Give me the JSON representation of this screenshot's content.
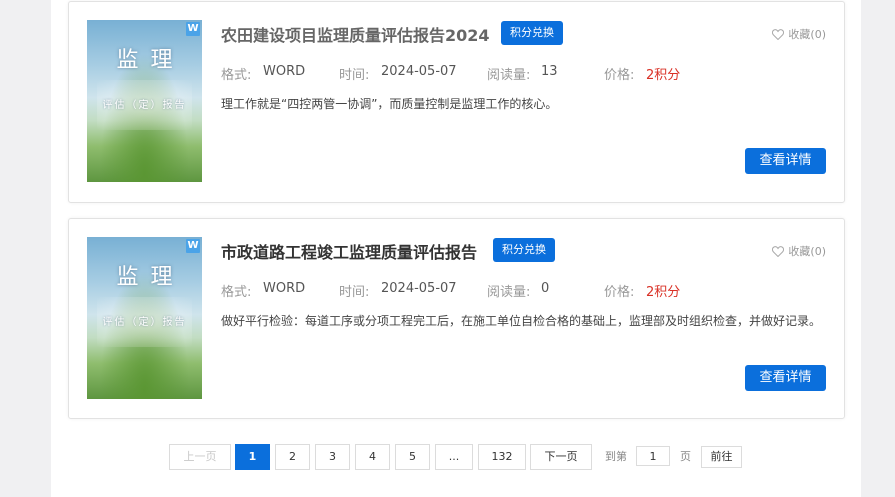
{
  "items": [
    {
      "cover": {
        "big": "监理",
        "small": "评估（定）报告",
        "badge": "W"
      },
      "title": "农田建设项目监理质量评估报告2024",
      "exchange_label": "积分兑换",
      "favorite_label": "收藏(0)",
      "format_label": "格式:",
      "format_value": "WORD",
      "time_label": "时间:",
      "time_value": "2024-05-07",
      "reads_label": "阅读量:",
      "reads_value": "13",
      "price_label": "价格:",
      "price_value": "2积分",
      "description": "理工作就是“四控两管一协调”，而质量控制是监理工作的核心。",
      "detail_label": "查看详情"
    },
    {
      "cover": {
        "big": "监理",
        "small": "评估（定）报告",
        "badge": "W"
      },
      "title": "市政道路工程竣工监理质量评估报告",
      "exchange_label": "积分兑换",
      "favorite_label": "收藏(0)",
      "format_label": "格式:",
      "format_value": "WORD",
      "time_label": "时间:",
      "time_value": "2024-05-07",
      "reads_label": "阅读量:",
      "reads_value": "0",
      "price_label": "价格:",
      "price_value": "2积分",
      "description": "做好平行检验：每道工序或分项工程完工后，在施工单位自检合格的基础上，监理部及时组织检查，并做好记录。",
      "detail_label": "查看详情"
    }
  ],
  "pagination": {
    "prev_label": "上一页",
    "pages": [
      "1",
      "2",
      "3",
      "4",
      "5",
      "...",
      "132"
    ],
    "current": "1",
    "next_label": "下一页",
    "goto_label": "到第",
    "goto_value": "1",
    "page_unit": "页",
    "go_label": "前往"
  },
  "colors": {
    "accent": "#0b6fdc",
    "price": "#d93025",
    "background": "#f0f0f2"
  }
}
